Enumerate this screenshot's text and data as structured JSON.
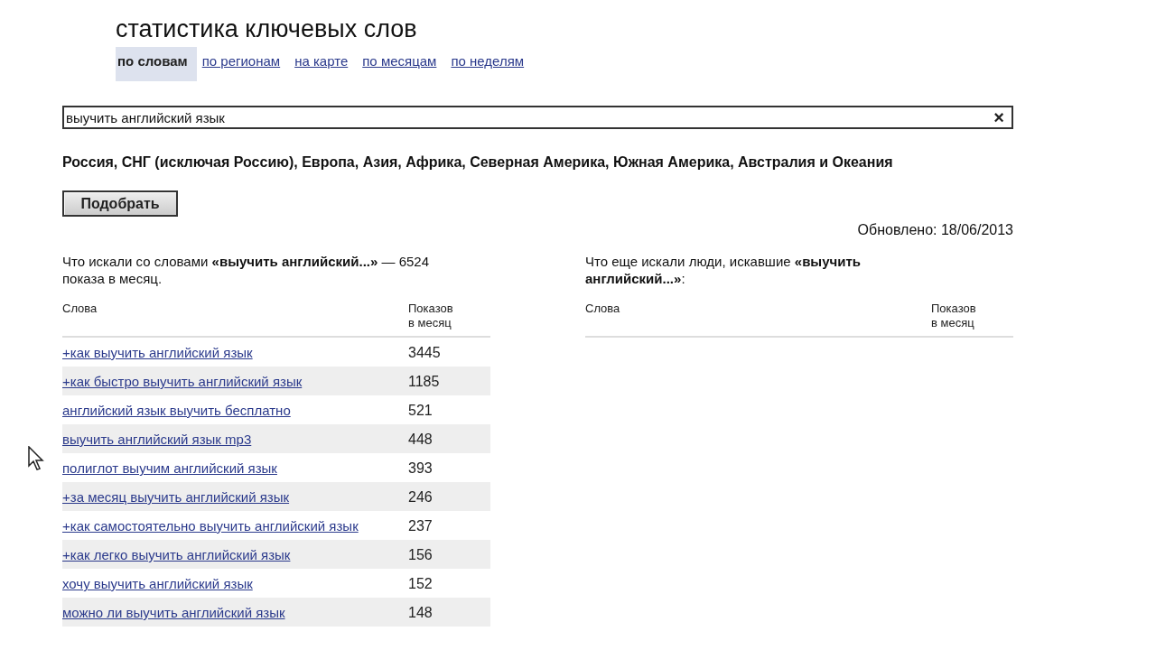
{
  "title": "статистика ключевых слов",
  "tabs": [
    {
      "label": "по словам",
      "selected": true
    },
    {
      "label": "по регионам",
      "selected": false
    },
    {
      "label": "на карте",
      "selected": false
    },
    {
      "label": "по месяцам",
      "selected": false
    },
    {
      "label": "по неделям",
      "selected": false
    }
  ],
  "search": {
    "value": "выучить английский язык",
    "clear": "×"
  },
  "regions": "Россия, СНГ (исключая Россию), Европа, Азия, Африка, Северная Америка, Южная Америка, Австралия и Океания",
  "submit": "Подобрать",
  "updated": "Обновлено: 18/06/2013",
  "left": {
    "heading": "Что искали со словами **«выучить английский...»** — 6524 показа в месяц.",
    "columns": [
      "Слова",
      "Показов в месяц"
    ],
    "rows": [
      {
        "phrase": "+как выучить английский язык",
        "count": "3445"
      },
      {
        "phrase": "+как быстро выучить английский язык",
        "count": "1185"
      },
      {
        "phrase": "английский язык выучить бесплатно",
        "count": "521"
      },
      {
        "phrase": "выучить английский язык mp3",
        "count": "448"
      },
      {
        "phrase": "полиглот выучим английский язык",
        "count": "393"
      },
      {
        "phrase": "+за месяц выучить английский язык",
        "count": "246"
      },
      {
        "phrase": "+как самостоятельно выучить английский язык",
        "count": "237"
      },
      {
        "phrase": "+как легко выучить английский язык",
        "count": "156"
      },
      {
        "phrase": "хочу выучить английский язык",
        "count": "152"
      },
      {
        "phrase": "можно ли выучить английский язык",
        "count": "148"
      }
    ]
  },
  "right": {
    "heading": "Что еще искали люди, искавшие **«выучить английский...»**:",
    "columns": [
      "Слова",
      "Показов в месяц"
    ]
  }
}
